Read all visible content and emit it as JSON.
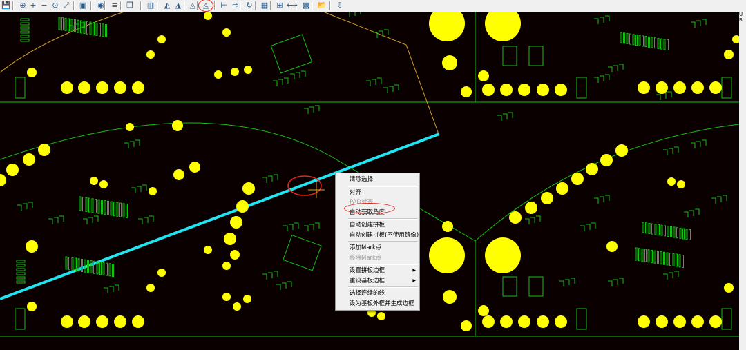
{
  "toolbar": {
    "buttons": [
      {
        "name": "save-icon",
        "glyph": "💾"
      },
      {
        "name": "zoom-icon",
        "glyph": "⊕"
      },
      {
        "name": "zoom-in-icon",
        "glyph": "+"
      },
      {
        "name": "zoom-out-icon",
        "glyph": "−"
      },
      {
        "name": "zoom-fit-icon",
        "glyph": "⊙"
      },
      {
        "name": "zoom-window-icon",
        "glyph": "⤢"
      },
      {
        "name": "layer-icon",
        "glyph": "▣"
      },
      {
        "name": "target-icon",
        "glyph": "◉"
      },
      {
        "name": "list-icon",
        "glyph": "≡"
      },
      {
        "name": "copy-icon",
        "glyph": "❐"
      },
      {
        "name": "align-icon",
        "glyph": "▥"
      },
      {
        "name": "mirror-left-icon",
        "glyph": "◭"
      },
      {
        "name": "mirror-right-icon",
        "glyph": "◮"
      },
      {
        "name": "mirror-icon",
        "glyph": "◬"
      },
      {
        "name": "auto-angle-icon",
        "glyph": "◬"
      },
      {
        "name": "distribute-icon",
        "glyph": "⊢"
      },
      {
        "name": "arrow-right-icon",
        "glyph": "⇨"
      },
      {
        "name": "rotate-icon",
        "glyph": "↻"
      },
      {
        "name": "board-icon",
        "glyph": "▦"
      },
      {
        "name": "component-icon",
        "glyph": "⊞"
      },
      {
        "name": "measure-icon",
        "glyph": "⟷"
      },
      {
        "name": "grid-icon",
        "glyph": "▩"
      },
      {
        "name": "open-icon",
        "glyph": "📂"
      },
      {
        "name": "export-icon",
        "glyph": "⇩"
      }
    ],
    "highlight_color": "#e0281b"
  },
  "right_strip": {
    "lines": [
      "U",
      "B"
    ]
  },
  "context_menu": {
    "items": [
      {
        "label": "清除选择",
        "enabled": true,
        "has_submenu": false
      },
      {
        "sep": true
      },
      {
        "label": "对齐",
        "enabled": true,
        "has_submenu": false
      },
      {
        "label": "PAD对齐",
        "enabled": false,
        "has_submenu": false
      },
      {
        "label": "自动获取角度",
        "enabled": true,
        "has_submenu": false,
        "highlighted": true
      },
      {
        "sep": true
      },
      {
        "label": "自动创建拼板",
        "enabled": true,
        "has_submenu": false
      },
      {
        "label": "自动创建拼板(不使用镜像)",
        "enabled": true,
        "has_submenu": false
      },
      {
        "sep": true
      },
      {
        "label": "添加Mark点",
        "enabled": true,
        "has_submenu": false
      },
      {
        "label": "移除Mark点",
        "enabled": false,
        "has_submenu": false
      },
      {
        "sep": true
      },
      {
        "label": "设置拼板边框",
        "enabled": true,
        "has_submenu": true
      },
      {
        "label": "重设基板边框",
        "enabled": true,
        "has_submenu": true
      },
      {
        "sep": true
      },
      {
        "label": "选择连续的线",
        "enabled": true,
        "has_submenu": false
      },
      {
        "label": "设为基板外框并生成边框",
        "enabled": true,
        "has_submenu": false
      }
    ]
  },
  "colors": {
    "background": "#0b0000",
    "pad_yellow": "#ffff00",
    "outline_green": "#12c112",
    "selected_line_cyan": "#20e4f0",
    "outline_orange": "#d4a02a",
    "annotation_red": "#e0281b"
  }
}
